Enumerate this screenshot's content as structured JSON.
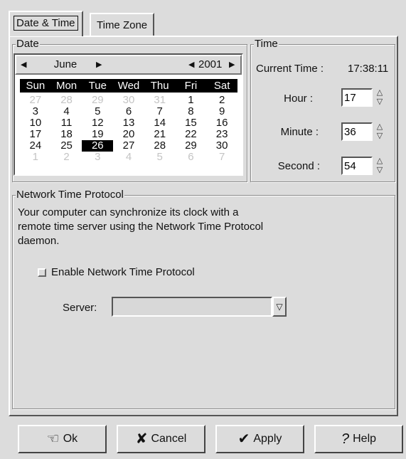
{
  "tabs": [
    {
      "label": "Date & Time"
    },
    {
      "label": "Time Zone"
    }
  ],
  "date": {
    "frame_title": "Date",
    "month": "June",
    "year": "2001",
    "day_names": [
      "Sun",
      "Mon",
      "Tue",
      "Wed",
      "Thu",
      "Fri",
      "Sat"
    ],
    "weeks": [
      [
        "27",
        "28",
        "29",
        "30",
        "31",
        "1",
        "2"
      ],
      [
        "3",
        "4",
        "5",
        "6",
        "7",
        "8",
        "9"
      ],
      [
        "10",
        "11",
        "12",
        "13",
        "14",
        "15",
        "16"
      ],
      [
        "17",
        "18",
        "19",
        "20",
        "21",
        "22",
        "23"
      ],
      [
        "24",
        "25",
        "26",
        "27",
        "28",
        "29",
        "30"
      ],
      [
        "1",
        "2",
        "3",
        "4",
        "5",
        "6",
        "7"
      ]
    ],
    "selected_day": "26"
  },
  "time": {
    "frame_title": "Time",
    "current_label": "Current Time :",
    "current_value": "17:38:11",
    "hour_label": "Hour :",
    "hour": "17",
    "minute_label": "Minute :",
    "minute": "36",
    "second_label": "Second :",
    "second": "54"
  },
  "ntp": {
    "frame_title": "Network Time Protocol",
    "description": "Your computer can synchronize its clock with a remote time server using the Network Time Protocol daemon.",
    "enable_label": "Enable Network Time Protocol",
    "enabled": false,
    "server_label": "Server:",
    "server_value": ""
  },
  "buttons": {
    "ok": "Ok",
    "cancel": "Cancel",
    "apply": "Apply",
    "help": "Help"
  },
  "icons": {
    "ok": "hand-pointing-icon",
    "cancel": "x-cross-icon",
    "apply": "checkmark-icon",
    "help": "question-mark-icon"
  }
}
